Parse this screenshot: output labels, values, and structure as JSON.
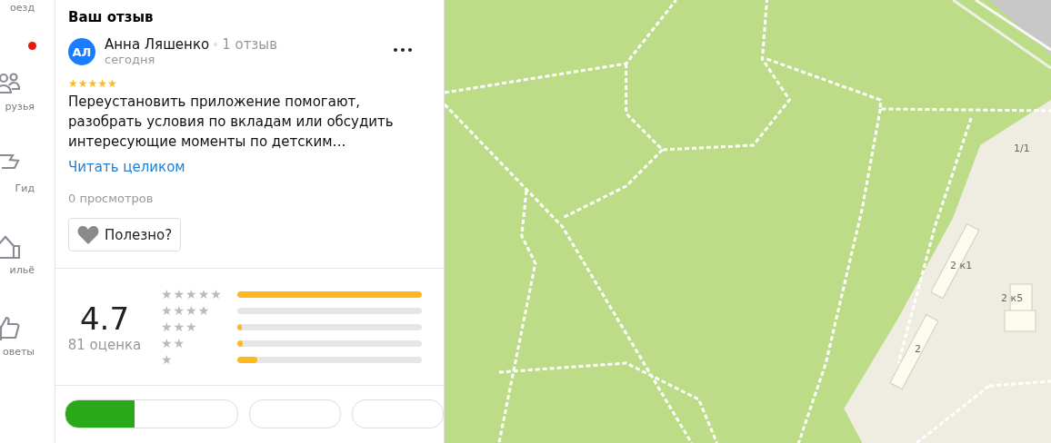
{
  "rail": {
    "items": [
      {
        "label": "оезд",
        "kind": "route",
        "badge": false
      },
      {
        "label": "рузья",
        "kind": "friends",
        "badge": true
      },
      {
        "label": "Гид",
        "kind": "flag",
        "badge": false
      },
      {
        "label": "ильё",
        "kind": "house",
        "badge": false
      },
      {
        "label": "оветы",
        "kind": "thumb",
        "badge": false
      }
    ]
  },
  "review": {
    "heading": "Ваш отзыв",
    "avatar": "АЛ",
    "author": "Анна Ляшенко",
    "author_reviews": "1 отзыв",
    "date": "сегодня",
    "stars": 5,
    "text": "Переустановить приложение помогают, разобрать условия по вкладам или обсудить интересующие моменты по детским…",
    "read_more": "Читать целиком",
    "views": "0 просмотров",
    "useful_button": "Полезно?"
  },
  "rating": {
    "score": "4.7",
    "count": "81 оценка",
    "rows": [
      {
        "label": "★★★★★",
        "level": 1
      },
      {
        "label": "★★★★",
        "level": 0
      },
      {
        "label": "★★★",
        "level": 0.01
      },
      {
        "label": "★★",
        "level": 0.03
      },
      {
        "label": "★",
        "level": 0.11
      }
    ]
  },
  "map": {
    "labels": [
      "1/1",
      "2 к1",
      "2 к5",
      "2"
    ]
  }
}
